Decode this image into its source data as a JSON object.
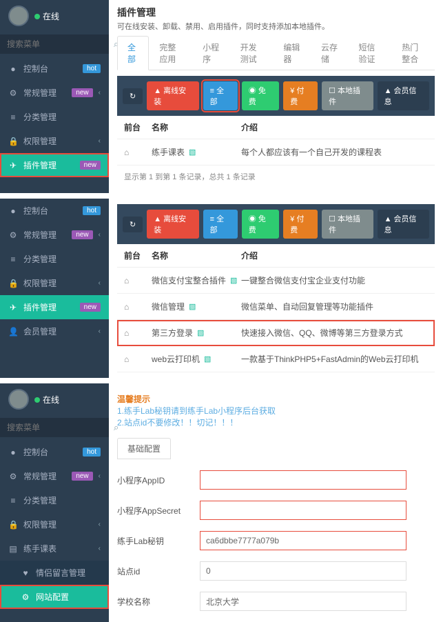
{
  "panel1": {
    "user_status": "在线",
    "search_placeholder": "搜索菜单",
    "nav": [
      {
        "icon": "●",
        "label": "控制台",
        "badge": "hot",
        "badge_class": "badge-hot"
      },
      {
        "icon": "⚙",
        "label": "常规管理",
        "badge": "new",
        "badge_class": "badge-new",
        "chevron": true
      },
      {
        "icon": "≡",
        "label": "分类管理"
      },
      {
        "icon": "🔒",
        "label": "权限管理",
        "chevron": true
      },
      {
        "icon": "✈",
        "label": "插件管理",
        "badge": "new",
        "badge_class": "badge-new",
        "active": true,
        "highlight": true
      }
    ],
    "page_title": "插件管理",
    "page_desc": "可在线安装、卸载、禁用、启用插件，同时支持添加本地插件。",
    "top_tabs": [
      "全部",
      "完整应用",
      "小程序",
      "开发测试",
      "编辑器",
      "云存储",
      "短信验证",
      "热门整合"
    ],
    "toolbar": [
      {
        "label": "↻",
        "class": "btn-refresh"
      },
      {
        "label": "▲ 离线安装",
        "class": "btn-red"
      },
      {
        "label": "≡ 全部",
        "class": "btn-blue",
        "highlight": true
      },
      {
        "label": "◉ 免费",
        "class": "btn-green"
      },
      {
        "label": "¥ 付费",
        "class": "btn-orange"
      },
      {
        "label": "☐ 本地插件",
        "class": "btn-gray"
      },
      {
        "label": "▲ 会员信息",
        "class": "btn-dark"
      }
    ],
    "table": {
      "headers": {
        "front": "前台",
        "name": "名称",
        "desc": "介绍"
      },
      "rows": [
        {
          "name": "练手课表",
          "desc": "每个人都应该有一个自己开发的课程表"
        }
      ]
    },
    "record_info": "显示第 1 到第 1 条记录，总共 1 条记录"
  },
  "panel2": {
    "nav": [
      {
        "icon": "●",
        "label": "控制台",
        "badge": "hot",
        "badge_class": "badge-hot"
      },
      {
        "icon": "⚙",
        "label": "常规管理",
        "badge": "new",
        "badge_class": "badge-new",
        "chevron": true
      },
      {
        "icon": "≡",
        "label": "分类管理"
      },
      {
        "icon": "🔒",
        "label": "权限管理",
        "chevron": true
      },
      {
        "icon": "✈",
        "label": "插件管理",
        "badge": "new",
        "badge_class": "badge-new",
        "active": true
      },
      {
        "icon": "👤",
        "label": "会员管理",
        "chevron": true
      }
    ],
    "toolbar": [
      {
        "label": "↻",
        "class": "btn-refresh"
      },
      {
        "label": "▲ 离线安装",
        "class": "btn-red"
      },
      {
        "label": "≡ 全部",
        "class": "btn-blue"
      },
      {
        "label": "◉ 免费",
        "class": "btn-green"
      },
      {
        "label": "¥ 付费",
        "class": "btn-orange"
      },
      {
        "label": "☐ 本地插件",
        "class": "btn-gray"
      },
      {
        "label": "▲ 会员信息",
        "class": "btn-dark"
      }
    ],
    "table": {
      "headers": {
        "front": "前台",
        "name": "名称",
        "desc": "介绍"
      },
      "rows": [
        {
          "name": "微信支付宝整合插件",
          "desc": "一键整合微信支付宝企业支付功能"
        },
        {
          "name": "微信管理",
          "desc": "微信菜单、自动回复管理等功能插件"
        },
        {
          "name": "第三方登录",
          "desc": "快速接入微信、QQ、微博等第三方登录方式",
          "highlight": true
        },
        {
          "name": "web云打印机",
          "desc": "一款基于ThinkPHP5+FastAdmin的Web云打印机"
        }
      ]
    }
  },
  "panel3": {
    "user_status": "在线",
    "search_placeholder": "搜索菜单",
    "nav": [
      {
        "icon": "●",
        "label": "控制台",
        "badge": "hot",
        "badge_class": "badge-hot"
      },
      {
        "icon": "⚙",
        "label": "常规管理",
        "badge": "new",
        "badge_class": "badge-new",
        "chevron": true
      },
      {
        "icon": "≡",
        "label": "分类管理"
      },
      {
        "icon": "🔒",
        "label": "权限管理",
        "chevron": true
      },
      {
        "icon": "▤",
        "label": "练手课表",
        "chevron": true
      }
    ],
    "sub_nav": [
      {
        "icon": "♥",
        "label": "情侣留言管理",
        "class": "love-item"
      },
      {
        "icon": "⚙",
        "label": "网站配置",
        "active": true,
        "highlight": true
      }
    ],
    "tip": {
      "title": "温馨提示",
      "lines": [
        "1.练手Lab秘钥请到练手Lab小程序后台获取",
        "2.站点id不要修改！！切记！！！"
      ]
    },
    "config_tab": "基础配置",
    "form": [
      {
        "label": "小程序AppID",
        "value": ""
      },
      {
        "label": "小程序AppSecret",
        "value": ""
      },
      {
        "label": "练手Lab秘钥",
        "value": "ca6dbbe7777a079b"
      },
      {
        "label": "站点id",
        "value": "0"
      },
      {
        "label": "学校名称",
        "value": "北京大学"
      }
    ]
  }
}
